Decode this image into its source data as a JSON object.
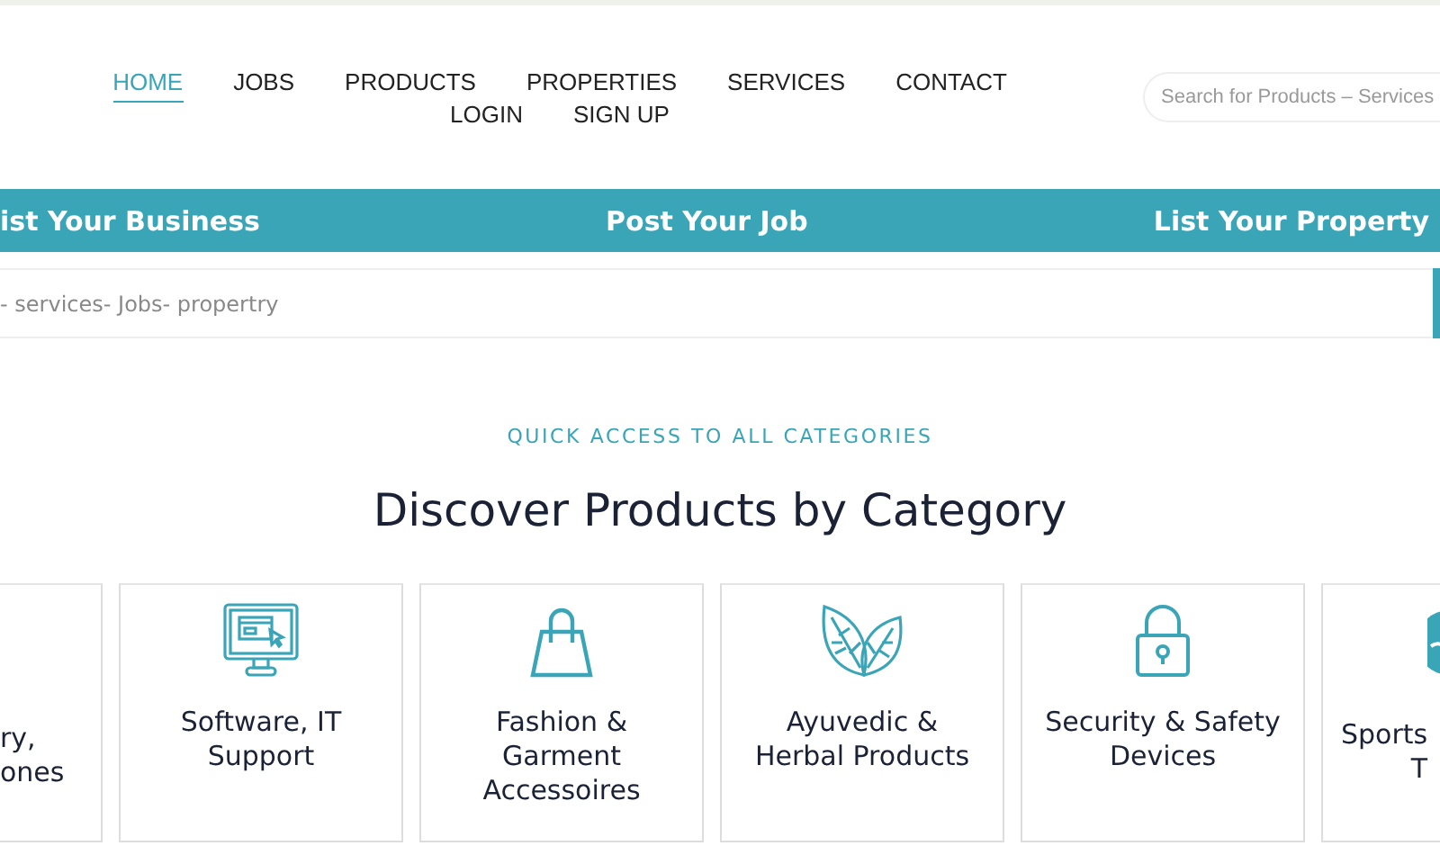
{
  "nav": {
    "items": [
      {
        "label": "HOME",
        "selected": true
      },
      {
        "label": "JOBS",
        "selected": false
      },
      {
        "label": "PRODUCTS",
        "selected": false
      },
      {
        "label": "PROPERTIES",
        "selected": false
      },
      {
        "label": "SERVICES",
        "selected": false
      },
      {
        "label": "CONTACT",
        "selected": false
      },
      {
        "label": "LOGIN",
        "selected": false
      },
      {
        "label": "SIGN UP",
        "selected": false
      }
    ],
    "search": {
      "placeholder": "Search for Products – Services"
    }
  },
  "action_bar": {
    "links": [
      "ist Your Business",
      "Post Your Job",
      "List Your Property"
    ]
  },
  "main_search": {
    "placeholder": "- services- Jobs- propertry"
  },
  "categories": {
    "eyebrow": "QUICK ACCESS TO ALL CATEGORIES",
    "heading": "Discover Products by Category",
    "cards": [
      {
        "kind": "partial-left",
        "lines": [
          "ry,",
          "ones"
        ]
      },
      {
        "kind": "computer",
        "lines": [
          "Software, IT",
          "Support"
        ]
      },
      {
        "kind": "bag",
        "lines": [
          "Fashion &",
          "Garment",
          "Accessoires"
        ]
      },
      {
        "kind": "leaves",
        "lines": [
          "Ayuvedic &",
          "Herbal Products"
        ]
      },
      {
        "kind": "lock",
        "lines": [
          "Security & Safety",
          "Devices"
        ]
      },
      {
        "kind": "partial-right",
        "lines": [
          "Sports",
          "T"
        ]
      }
    ]
  }
}
